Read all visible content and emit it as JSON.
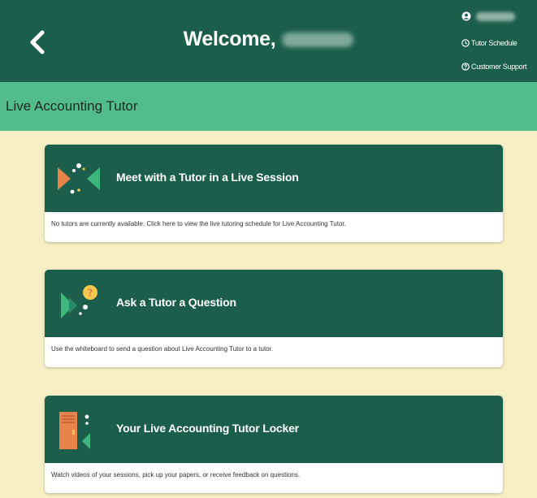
{
  "header": {
    "welcome_text": "Welcome,",
    "links": {
      "tutor_schedule": "Tutor Schedule",
      "customer_support": "Customer Support"
    }
  },
  "subheader": {
    "title": "Live Accounting Tutor"
  },
  "cards": [
    {
      "title": "Meet with a Tutor in a Live Session",
      "description": "No tutors are currently available. Click here to view the live tutoring schedule for Live Accounting Tutor.",
      "icon": "fish-meet-icon"
    },
    {
      "title": "Ask a Tutor a Question",
      "description": "Use the whiteboard to send a question about Live Accounting Tutor to a tutor.",
      "icon": "fish-question-icon"
    },
    {
      "title": "Your Live Accounting Tutor Locker",
      "description": "Watch videos of your sessions, pick up your papers, or receive feedback on questions.",
      "icon": "locker-icon"
    }
  ],
  "colors": {
    "header_bg": "#1b5e4b",
    "subbar_bg": "#52bd8b",
    "page_bg": "#f6efc4",
    "accent_orange": "#e8834a",
    "accent_green": "#3fb57f",
    "accent_yellow": "#f1c94e"
  }
}
